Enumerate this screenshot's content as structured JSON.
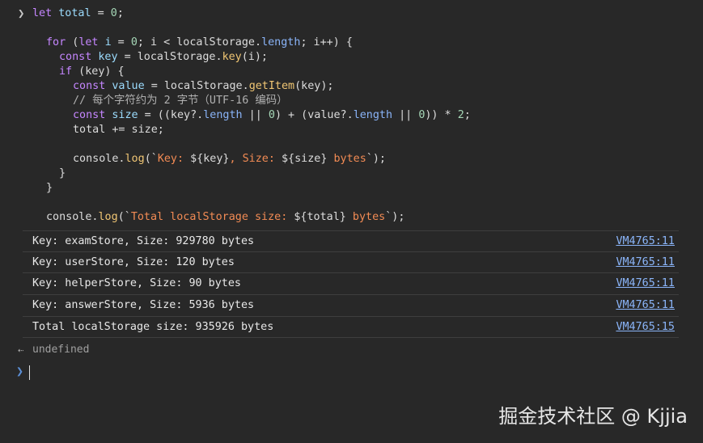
{
  "code": {
    "line1": {
      "kw": "let",
      "var": "total",
      "op": " = ",
      "num": "0",
      "end": ";"
    },
    "line3": {
      "kw": "for",
      "p1": " (",
      "kw2": "let",
      "var": "i",
      "op1": " = ",
      "num1": "0",
      "s1": "; ",
      "var2": "i",
      "op2": " < localStorage.",
      "prop": "length",
      "s2": "; i++) {"
    },
    "line4": {
      "kw": "const",
      "var": "key",
      "op": " = localStorage.",
      "fn": "key",
      "end": "(i);"
    },
    "line5": {
      "kw": "if",
      "end": " (key) {"
    },
    "line6": {
      "kw": "const",
      "var": "value",
      "op": " = localStorage.",
      "fn": "getItem",
      "end": "(key);"
    },
    "line7": {
      "comment": "// 每个字符约为 2 字节（UTF-16 编码）"
    },
    "line8": {
      "kw": "const",
      "var": "size",
      "p1": " = ((key?.",
      "prop1": "length",
      "p2": " || ",
      "num1": "0",
      "p3": ") + (value?.",
      "prop2": "length",
      "p4": " || ",
      "num2": "0",
      "p5": ")) * ",
      "num3": "2",
      "end": ";"
    },
    "line9": {
      "text": "total += size;"
    },
    "line11": {
      "pre": "console.",
      "fn": "log",
      "p1": "(`",
      "str1": "Key: ",
      "tl1": "${key}",
      "str2": ", Size: ",
      "tl2": "${size}",
      "str3": " bytes",
      "end": "`);"
    },
    "line12": {
      "text": "}"
    },
    "line13": {
      "text": "}"
    },
    "line15": {
      "pre": "console.",
      "fn": "log",
      "p1": "(`",
      "str1": "Total localStorage size: ",
      "tl1": "${total}",
      "str2": " bytes",
      "end": "`);"
    }
  },
  "logs": [
    {
      "text": "Key: examStore, Size: 929780 bytes",
      "source": "VM4765:11"
    },
    {
      "text": "Key: userStore, Size: 120 bytes",
      "source": "VM4765:11"
    },
    {
      "text": "Key: helperStore, Size: 90 bytes",
      "source": "VM4765:11"
    },
    {
      "text": "Key: answerStore, Size: 5936 bytes",
      "source": "VM4765:11"
    },
    {
      "text": "Total localStorage size: 935926 bytes",
      "source": "VM4765:15"
    }
  ],
  "result": {
    "text": "undefined"
  },
  "icons": {
    "input_prompt": "chevron-right-icon",
    "result_arrow": "return-arrow-icon",
    "console_prompt": "chevron-right-icon"
  },
  "watermark": {
    "text": "掘金技术社区 @ Kjjia"
  },
  "colors": {
    "background": "#282828",
    "keyword": "#c586ff",
    "string": "#f28b54",
    "link": "#8ab4f8",
    "function": "#f0c674",
    "number": "#a6d7b7"
  }
}
